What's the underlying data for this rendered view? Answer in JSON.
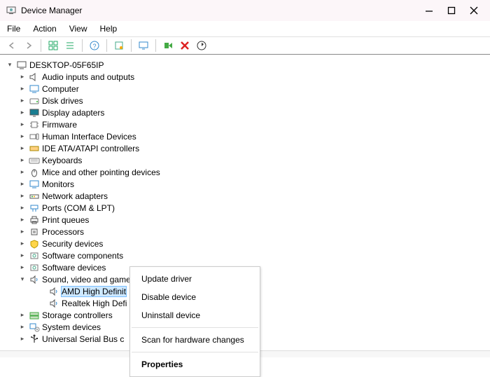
{
  "window": {
    "title": "Device Manager"
  },
  "menubar": {
    "file": "File",
    "action": "Action",
    "view": "View",
    "help": "Help"
  },
  "tree": {
    "root": "DESKTOP-05F65IP",
    "nodes": [
      "Audio inputs and outputs",
      "Computer",
      "Disk drives",
      "Display adapters",
      "Firmware",
      "Human Interface Devices",
      "IDE ATA/ATAPI controllers",
      "Keyboards",
      "Mice and other pointing devices",
      "Monitors",
      "Network adapters",
      "Ports (COM & LPT)",
      "Print queues",
      "Processors",
      "Security devices",
      "Software components",
      "Software devices",
      "Sound, video and game controllers",
      "Storage controllers",
      "System devices",
      "Universal Serial Bus c"
    ],
    "sound_children": {
      "amd": "AMD High Definit",
      "realtek": "Realtek High Defi"
    }
  },
  "context_menu": {
    "update": "Update driver",
    "disable": "Disable device",
    "uninstall": "Uninstall device",
    "scan": "Scan for hardware changes",
    "properties": "Properties"
  }
}
